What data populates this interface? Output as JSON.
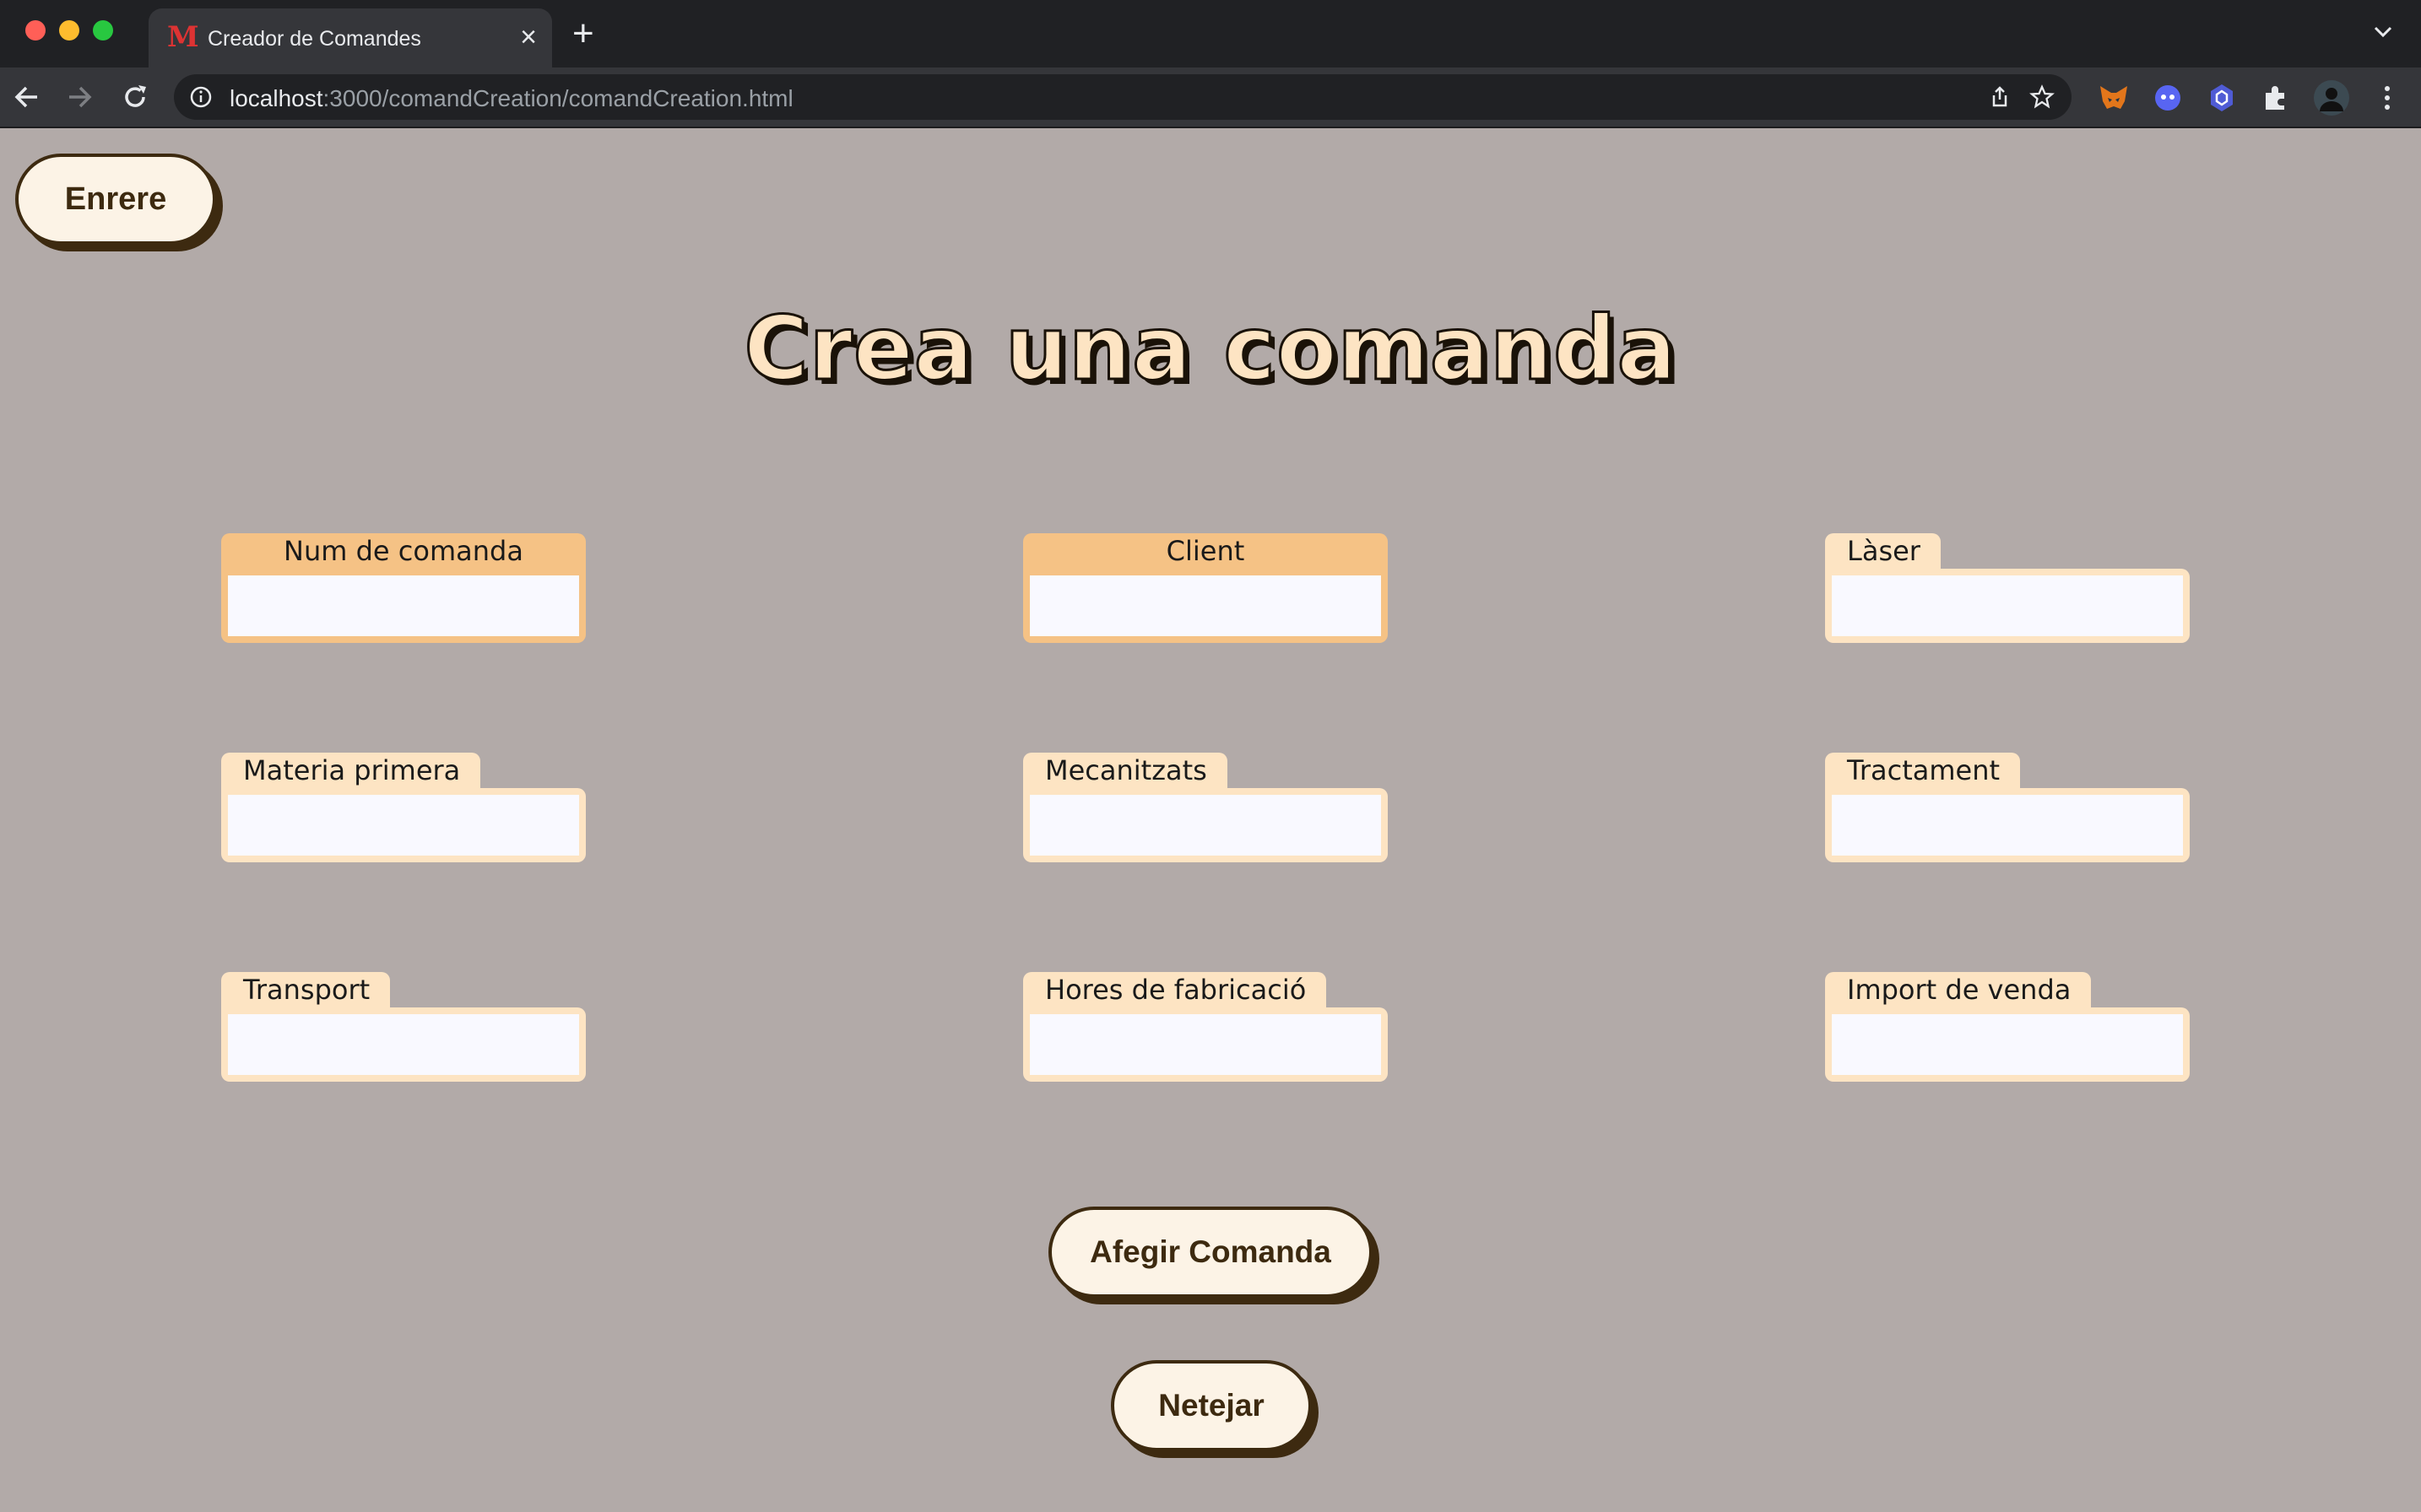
{
  "browser": {
    "tab_title": "Creador de Comandes",
    "favicon_letter": "M",
    "new_tab_label": "+",
    "tab_close_label": "×",
    "url_host": "localhost",
    "url_path": ":3000/comandCreation/comandCreation.html"
  },
  "page": {
    "back_label": "Enrere",
    "title": "Crea una comanda",
    "fields": [
      {
        "label": "Num de comanda",
        "value": ""
      },
      {
        "label": "Client",
        "value": ""
      },
      {
        "label": "Làser",
        "value": ""
      },
      {
        "label": "Materia primera",
        "value": ""
      },
      {
        "label": "Mecanitzats",
        "value": ""
      },
      {
        "label": "Tractament",
        "value": ""
      },
      {
        "label": "Transport",
        "value": ""
      },
      {
        "label": "Hores de fabricació",
        "value": ""
      },
      {
        "label": "Import de venda",
        "value": ""
      }
    ],
    "add_label": "Afegir Comanda",
    "clear_label": "Netejar"
  },
  "colors": {
    "page_background": "#b2aaa8",
    "required_field": "#f5c285",
    "field_label": "#fde4c3",
    "button_fill": "#fcf3e6",
    "button_border": "#3d2a10"
  }
}
